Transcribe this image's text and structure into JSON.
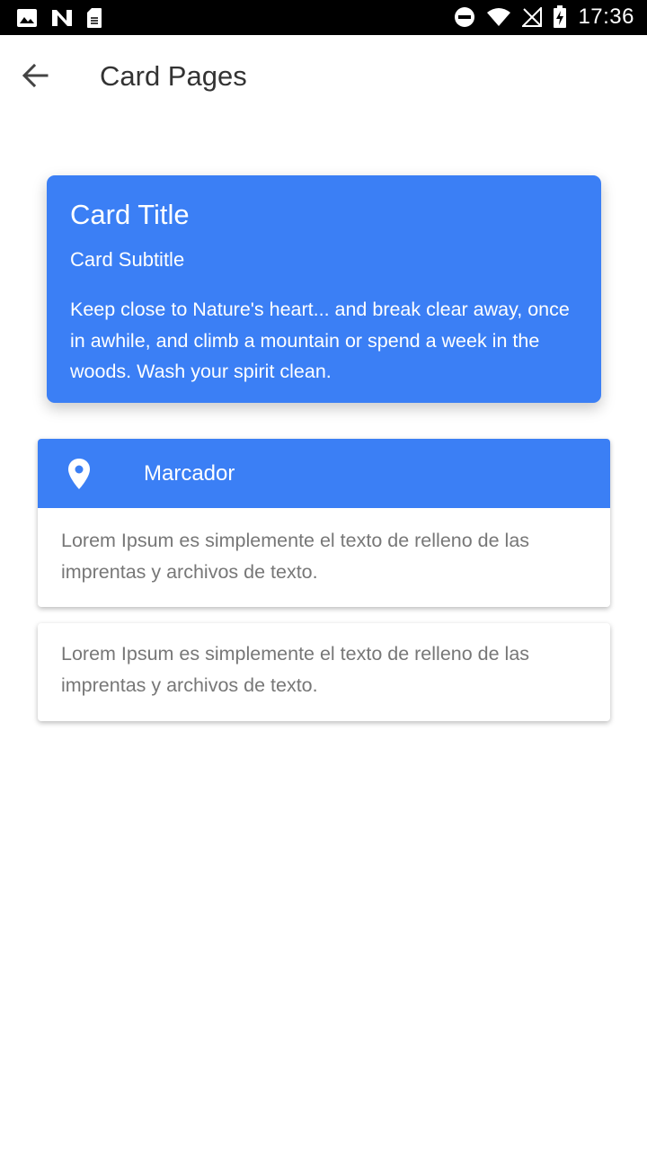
{
  "status_bar": {
    "time": "17:36",
    "left_icons": [
      "image-icon",
      "n-logo-icon",
      "sd-card-icon"
    ],
    "right_icons": [
      "do-not-disturb-icon",
      "wifi-icon",
      "no-signal-icon",
      "battery-charging-icon"
    ]
  },
  "app_bar": {
    "back_icon": "arrow-back-icon",
    "title": "Card Pages"
  },
  "card_blue": {
    "title": "Card Title",
    "subtitle": "Card Subtitle",
    "body": "Keep close to Nature's heart... and break clear away, once in awhile, and climb a mountain or spend a week in the woods. Wash your spirit clean.",
    "color": "#3b7ff5"
  },
  "card_marker": {
    "icon": "location-pin-icon",
    "label": "Marcador",
    "body": "Lorem Ipsum es simplemente el texto de relleno de las imprentas y archivos de texto."
  },
  "card_plain": {
    "body": "Lorem Ipsum es simplemente el texto de relleno de las imprentas y archivos de texto."
  },
  "colors": {
    "accent": "#3b7ff5",
    "statusbar": "#000000",
    "body_text": "#777777"
  }
}
